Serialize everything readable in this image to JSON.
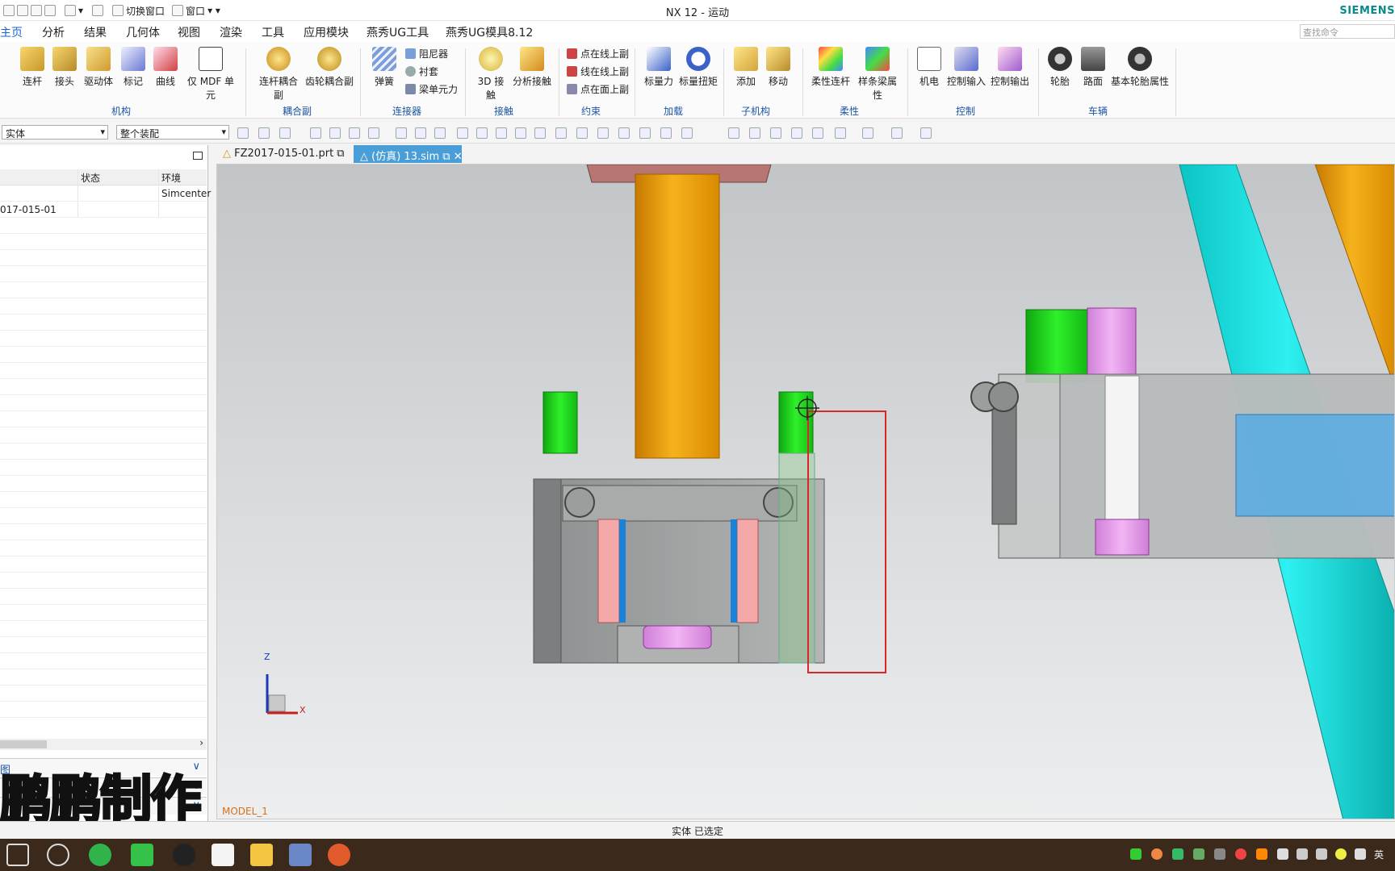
{
  "window": {
    "title": "NX 12 - 运动",
    "brand": "SIEMENS"
  },
  "quick_access": {
    "switch_window": "切换窗口",
    "window_menu": "窗口"
  },
  "menubar": {
    "items": [
      "主页",
      "分析",
      "结果",
      "几何体",
      "视图",
      "渲染",
      "工具",
      "应用模块",
      "燕秀UG工具",
      "燕秀UG模具8.12"
    ],
    "active": "主页"
  },
  "search": {
    "placeholder": "查找命令"
  },
  "ribbon": {
    "mechanism": {
      "group": "机构",
      "items": [
        "连杆",
        "接头",
        "驱动体",
        "标记",
        "曲线",
        "仅 MDF 单元"
      ]
    },
    "coupler": {
      "group": "耦合副",
      "items": [
        "连杆耦合副",
        "齿轮耦合副"
      ]
    },
    "connector": {
      "group": "连接器",
      "big": "弹簧",
      "small": [
        "阻尼器",
        "衬套",
        "梁单元力"
      ]
    },
    "contact": {
      "group": "接触",
      "items": [
        "3D 接触",
        "分析接触"
      ]
    },
    "constraint": {
      "group": "约束",
      "small": [
        "点在线上副",
        "线在线上副",
        "点在面上副"
      ]
    },
    "load": {
      "group": "加载",
      "items": [
        "标量力",
        "标量扭矩"
      ]
    },
    "submechanism": {
      "group": "子机构",
      "items": [
        "添加",
        "移动"
      ]
    },
    "flexible": {
      "group": "柔性",
      "items": [
        "柔性连杆",
        "样条梁属性"
      ]
    },
    "control": {
      "group": "控制",
      "items": [
        "机电",
        "控制输入",
        "控制输出"
      ]
    },
    "vehicle": {
      "group": "车辆",
      "items": [
        "轮胎",
        "路面",
        "基本轮胎属性"
      ]
    }
  },
  "toolbar2": {
    "filter": "实体",
    "scope": "整个装配"
  },
  "navigator": {
    "columns": [
      "状态",
      "环境"
    ],
    "rows": [
      {
        "status": "",
        "env": "Simcenter"
      },
      {
        "name": "017-015-01",
        "status": "",
        "env": ""
      }
    ],
    "accordions": [
      "图",
      "",
      ""
    ]
  },
  "tabs": [
    {
      "label": "FZ2017-015-01.prt",
      "active": false
    },
    {
      "label": "(仿真) 13.sim",
      "active": true
    }
  ],
  "viewport": {
    "model_name": "MODEL_1",
    "axis_x": "X",
    "axis_z": "Z"
  },
  "status": {
    "message": "实体 已选定"
  },
  "watermark": {
    "text": "鹏鹏制作"
  },
  "taskbar": {
    "tray_lang": "英"
  },
  "colors": {
    "accent": "#1a66c9",
    "tab_active": "#4a9ed8",
    "cylinder": "#f2a20c",
    "guide_green": "#1ed81a",
    "pink": "#f0a8a8",
    "magenta": "#e49be8",
    "cyan": "#16d8d8"
  }
}
